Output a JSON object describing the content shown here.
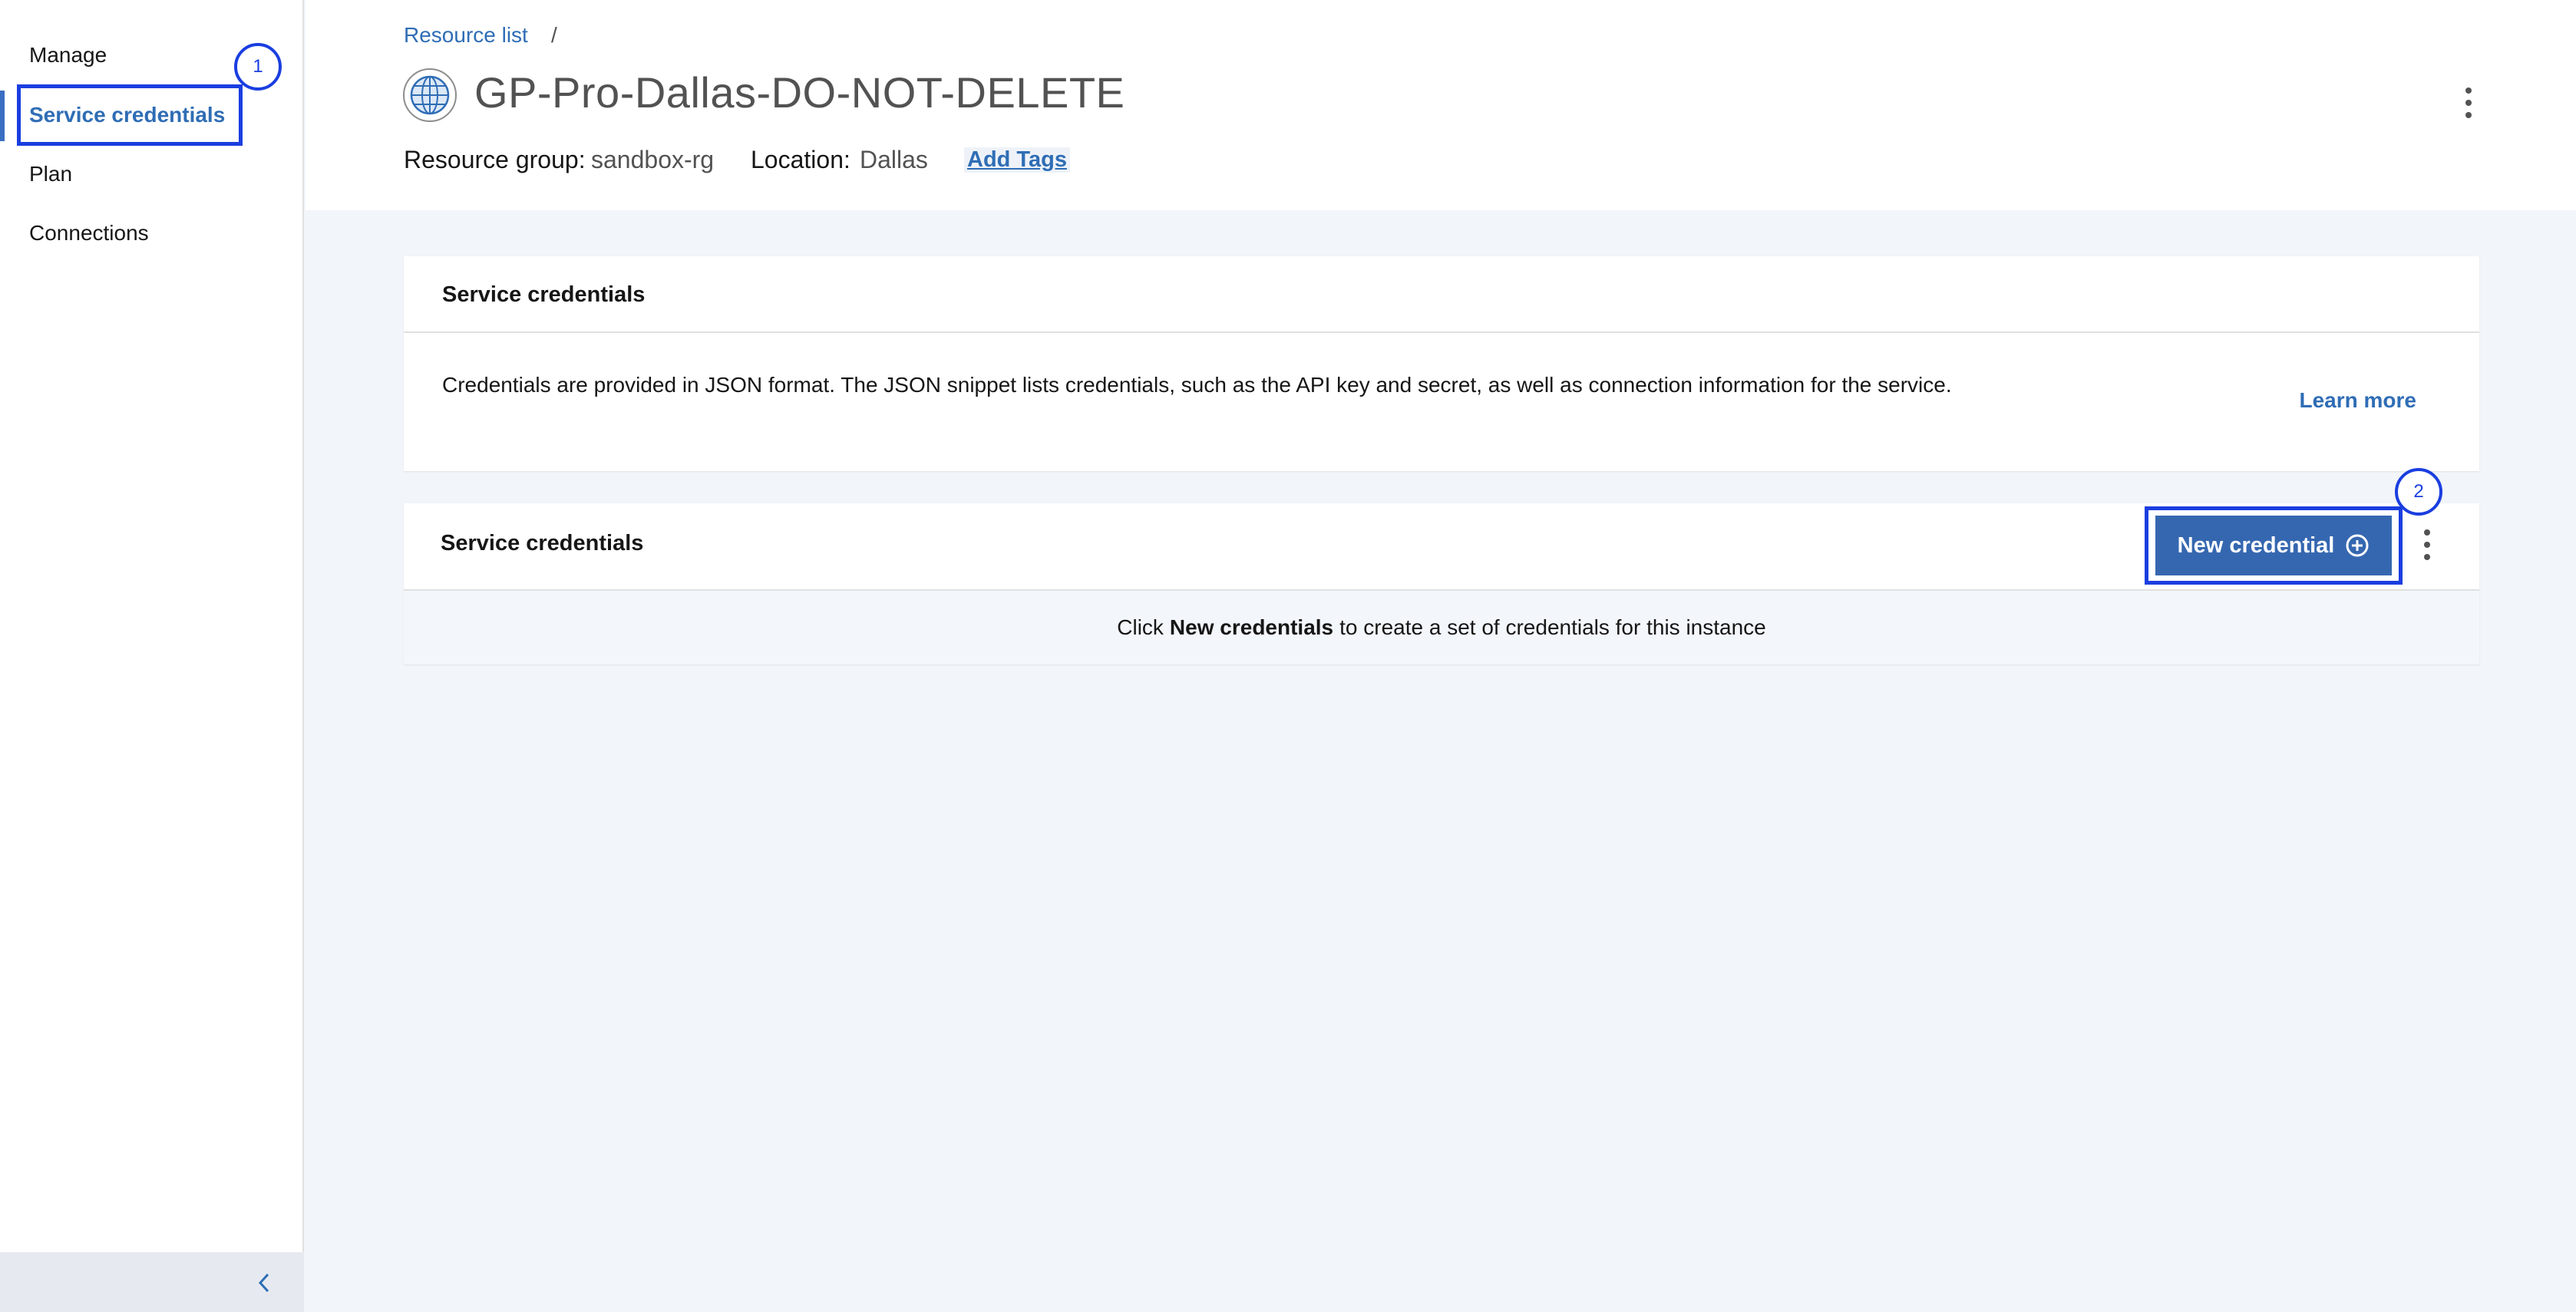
{
  "sidebar": {
    "items": [
      {
        "label": "Manage"
      },
      {
        "label": "Service credentials"
      },
      {
        "label": "Plan"
      },
      {
        "label": "Connections"
      }
    ],
    "collapse_icon": "chevron-left-icon"
  },
  "header": {
    "breadcrumb": {
      "link": "Resource list",
      "separator": "/"
    },
    "title": "GP-Pro-Dallas-DO-NOT-DELETE",
    "service_icon": "globe-icon",
    "resource_group_label": "Resource group:",
    "resource_group_value": "sandbox-rg",
    "location_label": "Location:",
    "location_value": "Dallas",
    "add_tags": "Add Tags"
  },
  "info_card": {
    "title": "Service credentials",
    "description": "Credentials are provided in JSON format. The JSON snippet lists credentials, such as the API key and secret, as well as connection information for the service.",
    "learn_more": "Learn more"
  },
  "credentials_card": {
    "title": "Service credentials",
    "new_button": "New credential",
    "new_button_icon": "add-circle-icon",
    "empty_prefix": "Click",
    "empty_bold": "New credentials",
    "empty_suffix": "to create a set of credentials for this instance"
  },
  "annotations": {
    "callout_1": "1",
    "callout_2": "2",
    "highlight_color": "#1a3ee0"
  },
  "colors": {
    "accent": "#2f6db5",
    "primary_button": "#3567b0",
    "page_background": "#f2f5f9"
  }
}
